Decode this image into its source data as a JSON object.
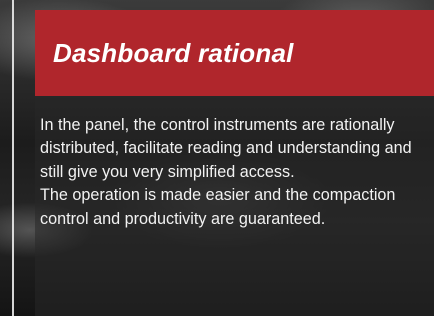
{
  "banner": {
    "title": "Dashboard rational",
    "accent_color": "#b0262c"
  },
  "body": {
    "paragraph_1": "In the panel, the control instruments are rationally distributed, facilitate reading and understanding and still give you very simplified access.",
    "paragraph_2": "The operation is made easier and the compaction control and productivity are guaranteed."
  }
}
